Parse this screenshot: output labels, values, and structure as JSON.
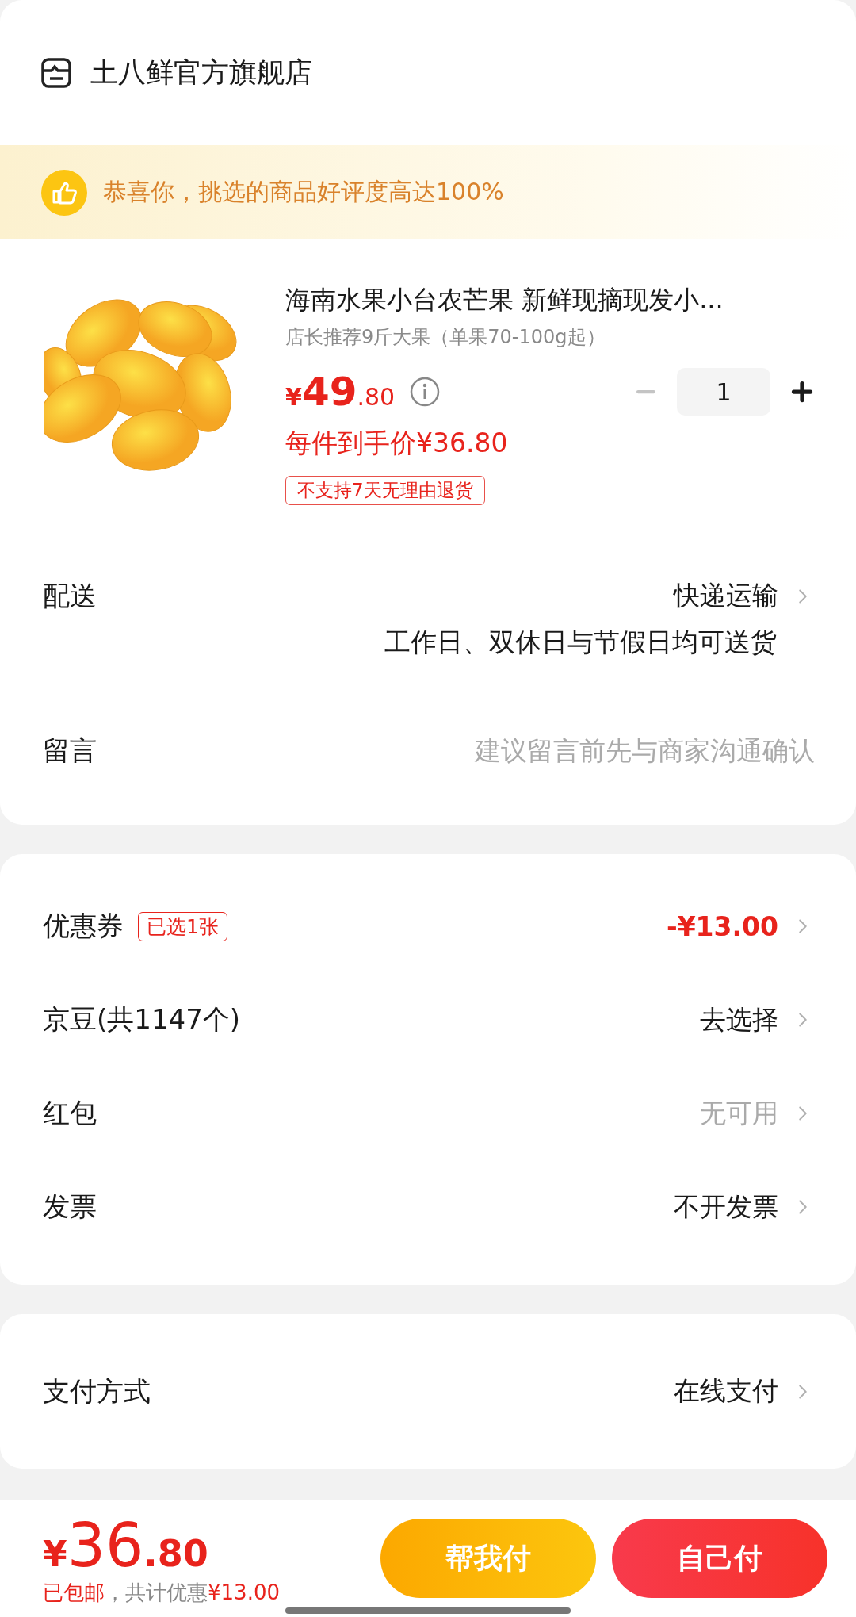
{
  "store": {
    "name": "土八鲜官方旗舰店"
  },
  "banner": {
    "text": "恭喜你，挑选的商品好评度高达100%"
  },
  "product": {
    "title": "海南水果小台农芒果 新鲜现摘现发小...",
    "spec": "店长推荐9斤大果（单果70-100g起）",
    "price_symbol": "¥",
    "price_int": "49",
    "price_dec": ".80",
    "net_price": "每件到手价¥36.80",
    "quantity": "1",
    "tag": "不支持7天无理由退货"
  },
  "order_rows": [
    {
      "kind": "value",
      "label": "配送",
      "value": "快递运输",
      "sub": "工作日、双休日与节假日均可送货"
    },
    {
      "kind": "placeholder",
      "label": "留言",
      "placeholder": "建议留言前先与商家沟通确认"
    }
  ],
  "discount_rows": [
    {
      "kind": "discount",
      "label": "优惠券",
      "badge": "已选1张",
      "value": "-¥13.00"
    },
    {
      "kind": "value",
      "label": "京豆(共1147个)",
      "value": "去选择"
    },
    {
      "kind": "muted",
      "label": "红包",
      "value": "无可用"
    },
    {
      "kind": "value",
      "label": "发票",
      "value": "不开发票"
    }
  ],
  "payment_rows": [
    {
      "kind": "value",
      "label": "支付方式",
      "value": "在线支付"
    }
  ],
  "footer": {
    "total_symbol": "¥",
    "total_int": "36",
    "total_dec": ".80",
    "note": [
      {
        "text": "已包邮",
        "highlight": true
      },
      {
        "text": "，共计优惠",
        "highlight": false
      },
      {
        "text": "¥13.00",
        "highlight": true
      }
    ],
    "buttons": [
      {
        "kind": "secondary",
        "label": "帮我付"
      },
      {
        "kind": "primary",
        "label": "自己付"
      }
    ]
  }
}
